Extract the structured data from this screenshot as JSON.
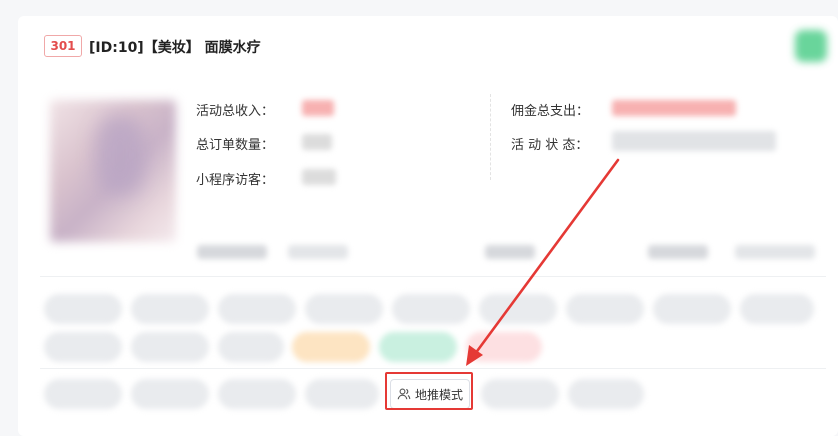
{
  "header": {
    "badge": "301",
    "title": "[ID:10]【美妆】 面膜水疗"
  },
  "stats": {
    "left": [
      {
        "label": "活动总收入："
      },
      {
        "label": "总订单数量："
      },
      {
        "label": "小程序访客："
      }
    ],
    "right": [
      {
        "label": "佣金总支出："
      },
      {
        "label": "活 动 状 态："
      }
    ]
  },
  "actions": {
    "mode_button": {
      "label": "地推模式",
      "icon": "user-group-icon"
    }
  },
  "colors": {
    "badge_red": "#e34d4d",
    "annotation_red": "#e53935",
    "status_green": "#37c77a"
  }
}
